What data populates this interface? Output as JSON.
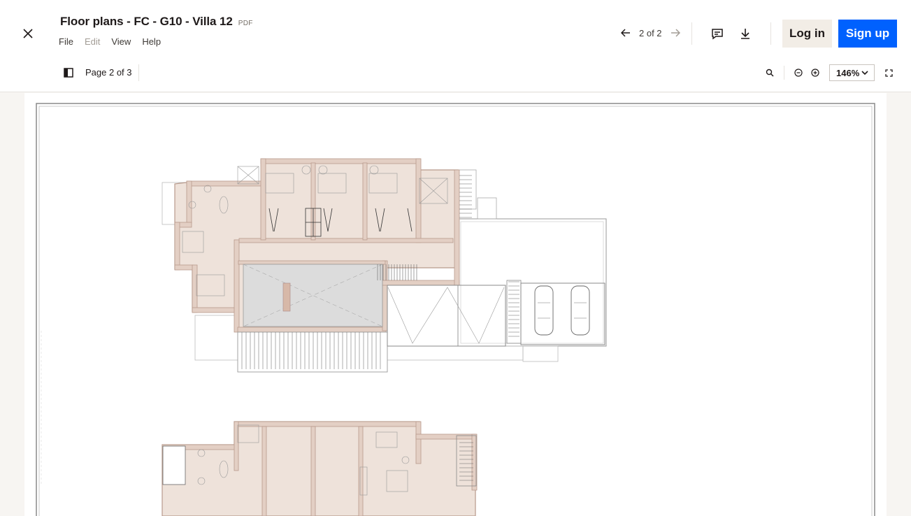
{
  "header": {
    "title": "Floor plans - FC - G10 - Villa 12",
    "file_type": "PDF",
    "menu": [
      "File",
      "Edit",
      "View",
      "Help"
    ],
    "pager_label": "2 of 2",
    "login_label": "Log in",
    "signup_label": "Sign up"
  },
  "toolbar": {
    "page_indicator": "Page 2 of 3",
    "zoom_level": "146%"
  },
  "icons": {
    "close": "close-icon",
    "prev": "arrow-left-icon",
    "next": "arrow-right-icon",
    "comment": "comment-icon",
    "download": "download-icon",
    "sidebar": "sidebar-panel-icon",
    "search": "search-icon",
    "zoom_out": "zoom-out-icon",
    "zoom_in": "zoom-in-icon",
    "fullscreen": "fullscreen-icon"
  },
  "colors": {
    "brand_blue": "#0061fe",
    "login_bg": "#f2ede6",
    "wall_fill": "#e3cfc4",
    "wall_stroke": "#b89a8c"
  }
}
